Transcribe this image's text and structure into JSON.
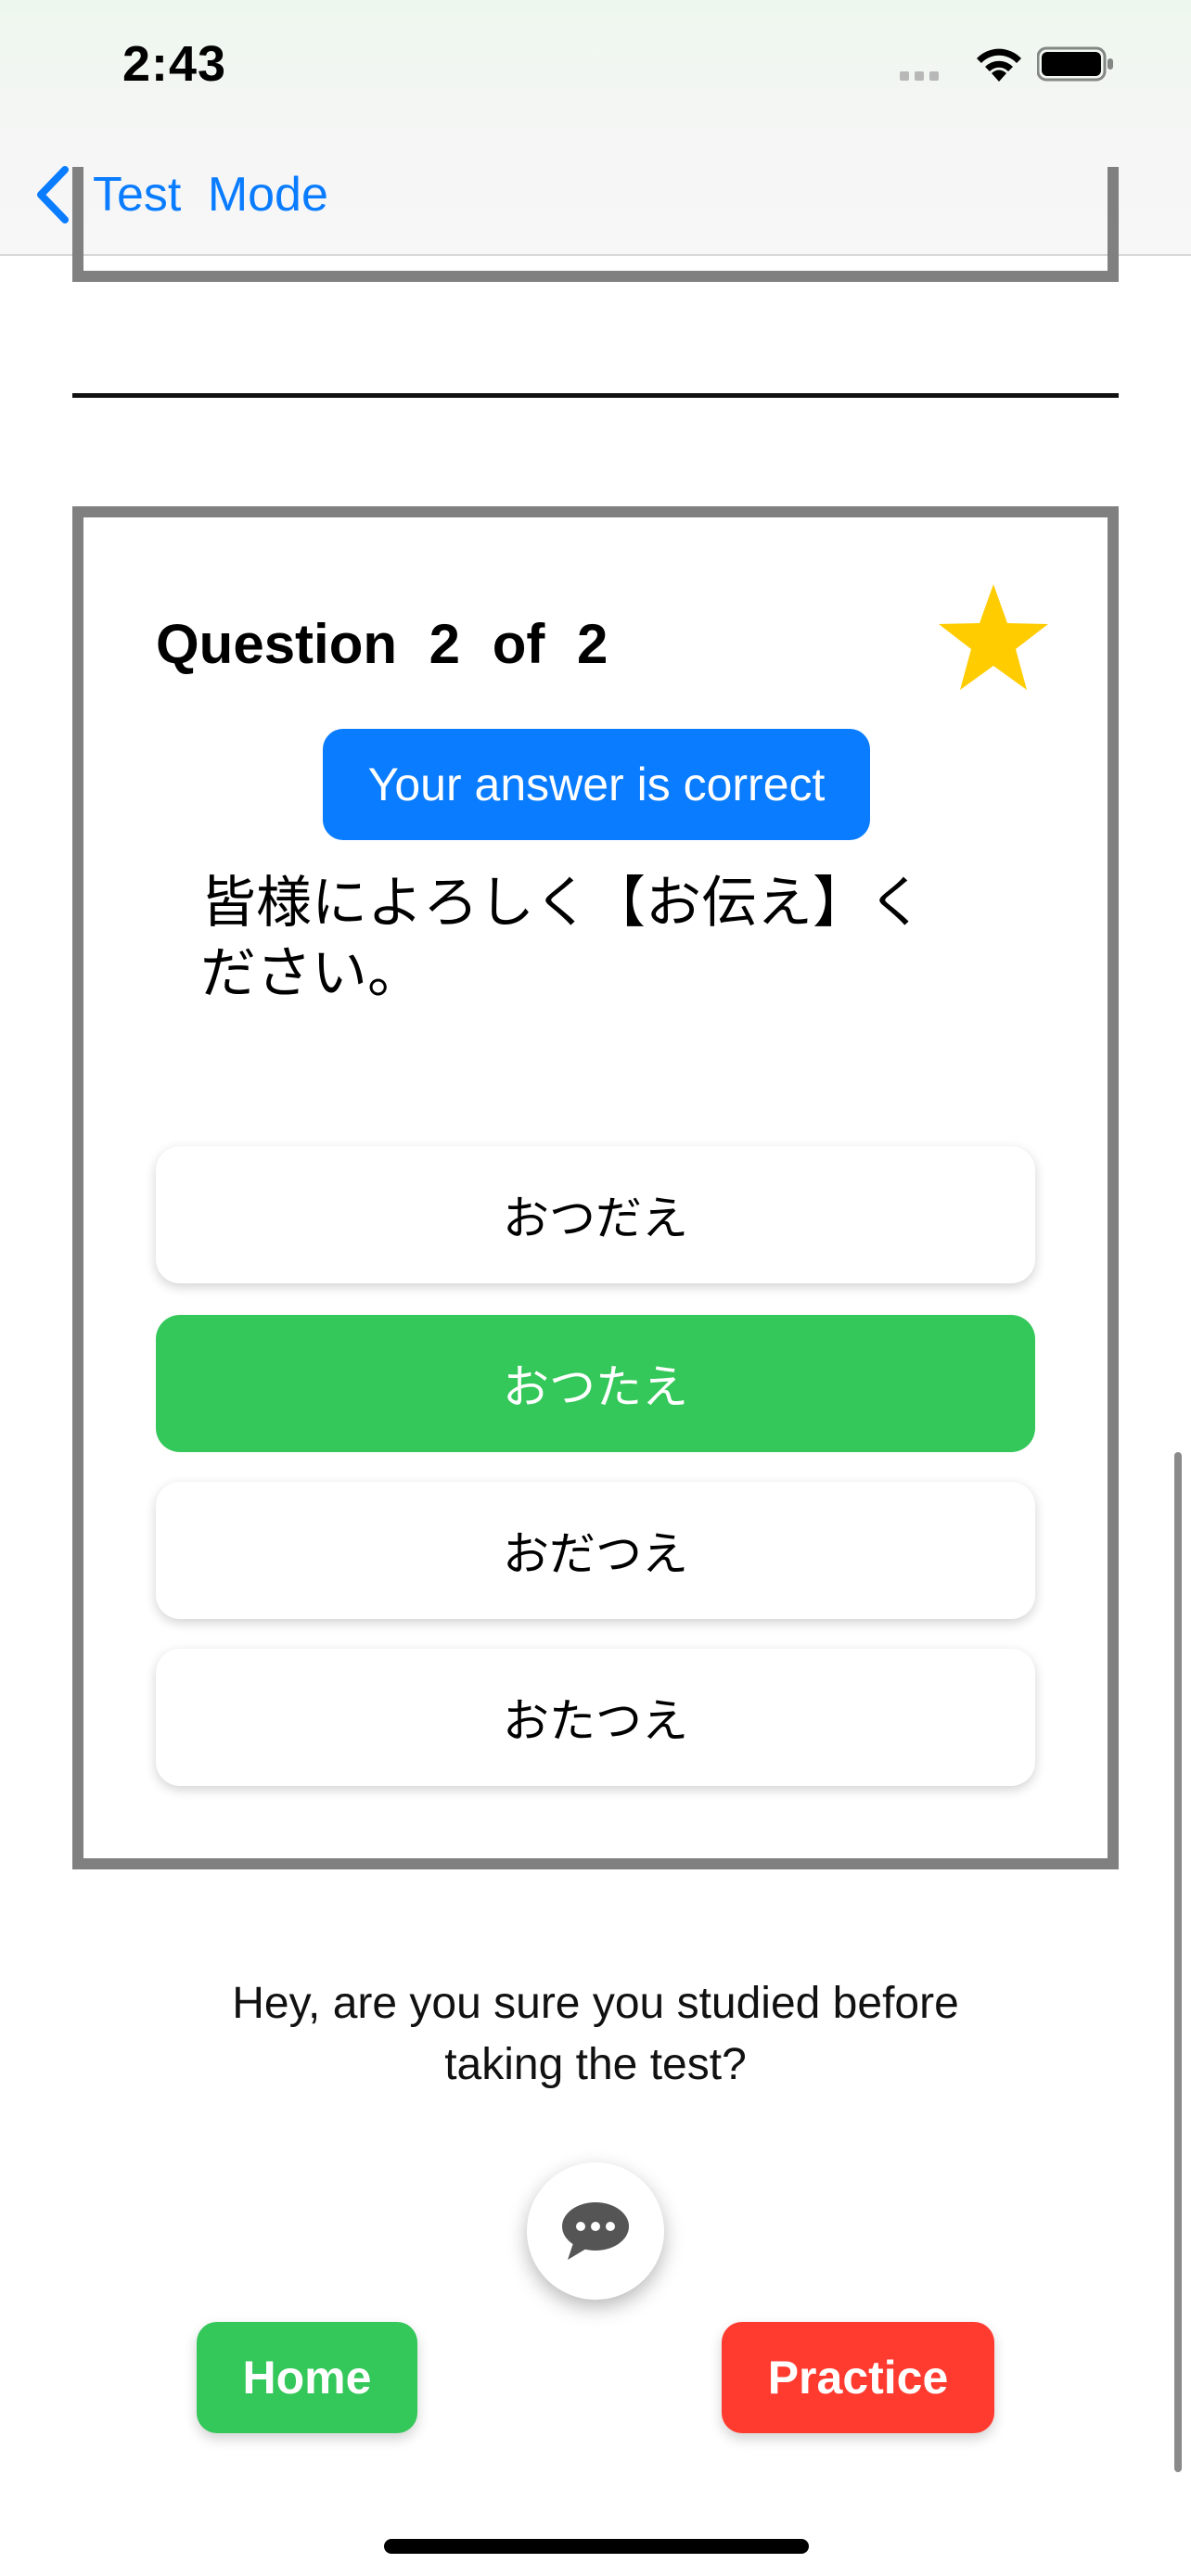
{
  "status_bar": {
    "time": "2:43"
  },
  "nav": {
    "back_label": "Test Mode"
  },
  "question": {
    "title": "Question 2 of 2",
    "result_badge": "Your answer is correct",
    "text": "皆様によろしく【お伝え】ください。",
    "options": [
      "おつだえ",
      "おつたえ",
      "おだつえ",
      "おたつえ"
    ],
    "correct_index": 1,
    "starred": true
  },
  "message": "Hey, are you sure you studied before taking the test?",
  "buttons": {
    "home": "Home",
    "practice": "Practice"
  },
  "colors": {
    "accent_blue": "#0a7cff",
    "correct_green": "#34c759",
    "practice_red": "#ff3b30",
    "star_yellow": "#ffcc00",
    "card_border": "#808080"
  },
  "icons": [
    "chevron-left-icon",
    "wifi-icon",
    "battery-icon",
    "signal-icon",
    "star-icon",
    "chat-bubble-icon"
  ]
}
